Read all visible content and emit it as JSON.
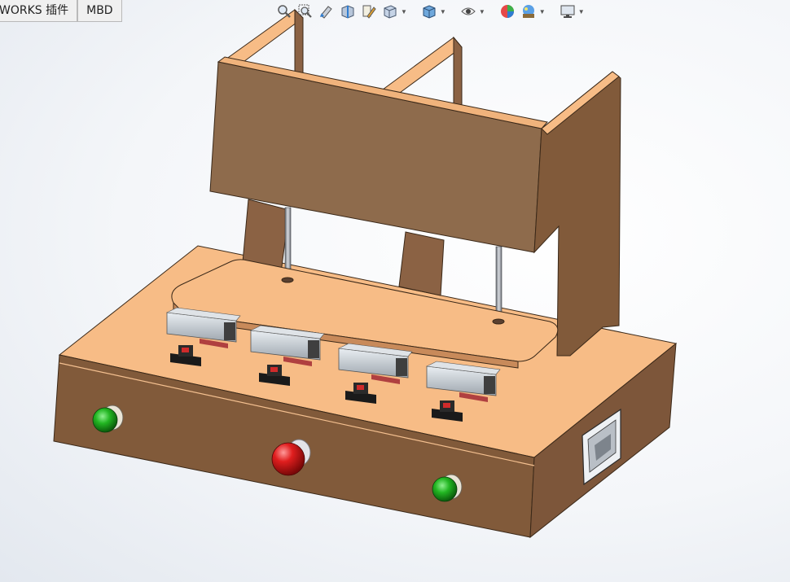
{
  "command_manager": {
    "tabs": [
      {
        "label": "WORKS 插件"
      },
      {
        "label": "MBD"
      }
    ]
  },
  "heads_up_toolbar": {
    "buttons": [
      {
        "icon": "zoom-to-fit-icon"
      },
      {
        "icon": "zoom-to-area-icon"
      },
      {
        "icon": "previous-view-icon"
      },
      {
        "icon": "section-view-icon"
      },
      {
        "icon": "dynamic-annotation-icon"
      },
      {
        "icon": "view-orientation-icon",
        "has_dropdown": true
      },
      {
        "icon": "display-style-icon",
        "has_dropdown": true
      },
      {
        "icon": "hide-show-items-icon",
        "has_dropdown": true
      },
      {
        "icon": "edit-appearance-icon"
      },
      {
        "icon": "apply-scene-icon",
        "has_dropdown": true
      },
      {
        "icon": "view-settings-icon",
        "has_dropdown": true
      }
    ]
  },
  "model": {
    "colors": {
      "wood_top": "#f7bc86",
      "wood_front": "#815a3a",
      "wood_side": "#7d563a",
      "panel": "#8e6b4c",
      "edge": "#3a2818",
      "green_button": "#1faa1f",
      "red_button": "#d81e1e"
    },
    "parts": [
      "base-box",
      "back-frame",
      "press-plate",
      "guide-rods",
      "fixtures",
      "start-button-left",
      "emergency-stop-button",
      "start-button-right",
      "side-switch"
    ]
  }
}
